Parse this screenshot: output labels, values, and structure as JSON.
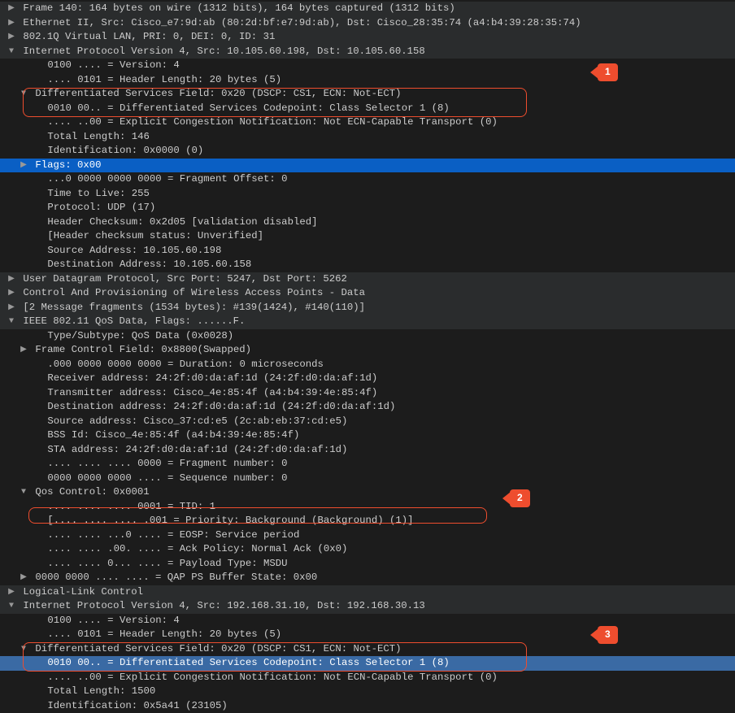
{
  "rows": [
    {
      "indent": 0,
      "arrow": "right",
      "top": true,
      "text_key": "r.0"
    },
    {
      "indent": 0,
      "arrow": "right",
      "top": true,
      "text_key": "r.1"
    },
    {
      "indent": 0,
      "arrow": "right",
      "top": true,
      "text_key": "r.2"
    },
    {
      "indent": 0,
      "arrow": "down",
      "top": true,
      "text_key": "r.3"
    },
    {
      "indent": 2,
      "arrow": "",
      "text_key": "r.4"
    },
    {
      "indent": 2,
      "arrow": "",
      "text_key": "r.5"
    },
    {
      "indent": 1,
      "arrow": "down",
      "text_key": "r.6"
    },
    {
      "indent": 2,
      "arrow": "",
      "text_key": "r.7"
    },
    {
      "indent": 2,
      "arrow": "",
      "text_key": "r.8"
    },
    {
      "indent": 2,
      "arrow": "",
      "text_key": "r.9"
    },
    {
      "indent": 2,
      "arrow": "",
      "text_key": "r.10"
    },
    {
      "indent": 1,
      "arrow": "right",
      "sel": true,
      "text_key": "r.11"
    },
    {
      "indent": 2,
      "arrow": "",
      "text_key": "r.12"
    },
    {
      "indent": 2,
      "arrow": "",
      "text_key": "r.13"
    },
    {
      "indent": 2,
      "arrow": "",
      "text_key": "r.14"
    },
    {
      "indent": 2,
      "arrow": "",
      "text_key": "r.15"
    },
    {
      "indent": 2,
      "arrow": "",
      "text_key": "r.16"
    },
    {
      "indent": 2,
      "arrow": "",
      "text_key": "r.17"
    },
    {
      "indent": 2,
      "arrow": "",
      "text_key": "r.18"
    },
    {
      "indent": 0,
      "arrow": "right",
      "top": true,
      "text_key": "r.19"
    },
    {
      "indent": 0,
      "arrow": "right",
      "top": true,
      "text_key": "r.20"
    },
    {
      "indent": 0,
      "arrow": "right",
      "top": true,
      "text_key": "r.21"
    },
    {
      "indent": 0,
      "arrow": "down",
      "top": true,
      "text_key": "r.22"
    },
    {
      "indent": 2,
      "arrow": "",
      "text_key": "r.23"
    },
    {
      "indent": 1,
      "arrow": "right",
      "text_key": "r.24"
    },
    {
      "indent": 2,
      "arrow": "",
      "text_key": "r.25"
    },
    {
      "indent": 2,
      "arrow": "",
      "text_key": "r.26"
    },
    {
      "indent": 2,
      "arrow": "",
      "text_key": "r.27"
    },
    {
      "indent": 2,
      "arrow": "",
      "text_key": "r.28"
    },
    {
      "indent": 2,
      "arrow": "",
      "text_key": "r.29"
    },
    {
      "indent": 2,
      "arrow": "",
      "text_key": "r.30"
    },
    {
      "indent": 2,
      "arrow": "",
      "text_key": "r.31"
    },
    {
      "indent": 2,
      "arrow": "",
      "text_key": "r.32"
    },
    {
      "indent": 2,
      "arrow": "",
      "text_key": "r.33"
    },
    {
      "indent": 1,
      "arrow": "down",
      "text_key": "r.34"
    },
    {
      "indent": 2,
      "arrow": "",
      "text_key": "r.35"
    },
    {
      "indent": 2,
      "arrow": "",
      "text_key": "r.36"
    },
    {
      "indent": 2,
      "arrow": "",
      "text_key": "r.37"
    },
    {
      "indent": 2,
      "arrow": "",
      "text_key": "r.38"
    },
    {
      "indent": 2,
      "arrow": "",
      "text_key": "r.39"
    },
    {
      "indent": 1,
      "arrow": "right",
      "text_key": "r.40"
    },
    {
      "indent": 0,
      "arrow": "right",
      "top": true,
      "text_key": "r.41"
    },
    {
      "indent": 0,
      "arrow": "down",
      "top": true,
      "text_key": "r.42"
    },
    {
      "indent": 2,
      "arrow": "",
      "text_key": "r.43"
    },
    {
      "indent": 2,
      "arrow": "",
      "text_key": "r.44"
    },
    {
      "indent": 1,
      "arrow": "down",
      "text_key": "r.45"
    },
    {
      "indent": 2,
      "arrow": "",
      "sel2": true,
      "text_key": "r.46"
    },
    {
      "indent": 2,
      "arrow": "",
      "text_key": "r.47"
    },
    {
      "indent": 2,
      "arrow": "",
      "text_key": "r.48"
    },
    {
      "indent": 2,
      "arrow": "",
      "text_key": "r.49"
    }
  ],
  "r": {
    "0": "Frame 140: 164 bytes on wire (1312 bits), 164 bytes captured (1312 bits)",
    "1": "Ethernet II, Src: Cisco_e7:9d:ab (80:2d:bf:e7:9d:ab), Dst: Cisco_28:35:74 (a4:b4:39:28:35:74)",
    "2": "802.1Q Virtual LAN, PRI: 0, DEI: 0, ID: 31",
    "3": "Internet Protocol Version 4, Src: 10.105.60.198, Dst: 10.105.60.158",
    "4": "0100 .... = Version: 4",
    "5": ".... 0101 = Header Length: 20 bytes (5)",
    "6": "Differentiated Services Field: 0x20 (DSCP: CS1, ECN: Not-ECT)",
    "7": "0010 00.. = Differentiated Services Codepoint: Class Selector 1 (8)",
    "8": ".... ..00 = Explicit Congestion Notification: Not ECN-Capable Transport (0)",
    "9": "Total Length: 146",
    "10": "Identification: 0x0000 (0)",
    "11": "Flags: 0x00",
    "12": "...0 0000 0000 0000 = Fragment Offset: 0",
    "13": "Time to Live: 255",
    "14": "Protocol: UDP (17)",
    "15": "Header Checksum: 0x2d05 [validation disabled]",
    "16": "[Header checksum status: Unverified]",
    "17": "Source Address: 10.105.60.198",
    "18": "Destination Address: 10.105.60.158",
    "19": "User Datagram Protocol, Src Port: 5247, Dst Port: 5262",
    "20": "Control And Provisioning of Wireless Access Points - Data",
    "21": "[2 Message fragments (1534 bytes): #139(1424), #140(110)]",
    "22": "IEEE 802.11 QoS Data, Flags: ......F.",
    "23": "Type/Subtype: QoS Data (0x0028)",
    "24": "Frame Control Field: 0x8800(Swapped)",
    "25": ".000 0000 0000 0000 = Duration: 0 microseconds",
    "26": "Receiver address: 24:2f:d0:da:af:1d (24:2f:d0:da:af:1d)",
    "27": "Transmitter address: Cisco_4e:85:4f (a4:b4:39:4e:85:4f)",
    "28": "Destination address: 24:2f:d0:da:af:1d (24:2f:d0:da:af:1d)",
    "29": "Source address: Cisco_37:cd:e5 (2c:ab:eb:37:cd:e5)",
    "30": "BSS Id: Cisco_4e:85:4f (a4:b4:39:4e:85:4f)",
    "31": "STA address: 24:2f:d0:da:af:1d (24:2f:d0:da:af:1d)",
    "32": ".... .... .... 0000 = Fragment number: 0",
    "33": "0000 0000 0000 .... = Sequence number: 0",
    "34": "Qos Control: 0x0001",
    "35": ".... .... .... 0001 = TID: 1",
    "36": "[.... .... .... .001 = Priority: Background (Background) (1)]",
    "37": ".... .... ...0 .... = EOSP: Service period",
    "38": ".... .... .00. .... = Ack Policy: Normal Ack (0x0)",
    "39": ".... .... 0... .... = Payload Type: MSDU",
    "40": "0000 0000 .... .... = QAP PS Buffer State: 0x00",
    "41": "Logical-Link Control",
    "42": "Internet Protocol Version 4, Src: 192.168.31.10, Dst: 192.168.30.13",
    "43": "0100 .... = Version: 4",
    "44": ".... 0101 = Header Length: 20 bytes (5)",
    "45": "Differentiated Services Field: 0x20 (DSCP: CS1, ECN: Not-ECT)",
    "46": "0010 00.. = Differentiated Services Codepoint: Class Selector 1 (8)",
    "47": ".... ..00 = Explicit Congestion Notification: Not ECN-Capable Transport (0)",
    "48": "Total Length: 1500",
    "49": "Identification: 0x5a41 (23105)"
  },
  "callouts": {
    "c1": "1",
    "c2": "2",
    "c3": "3"
  }
}
